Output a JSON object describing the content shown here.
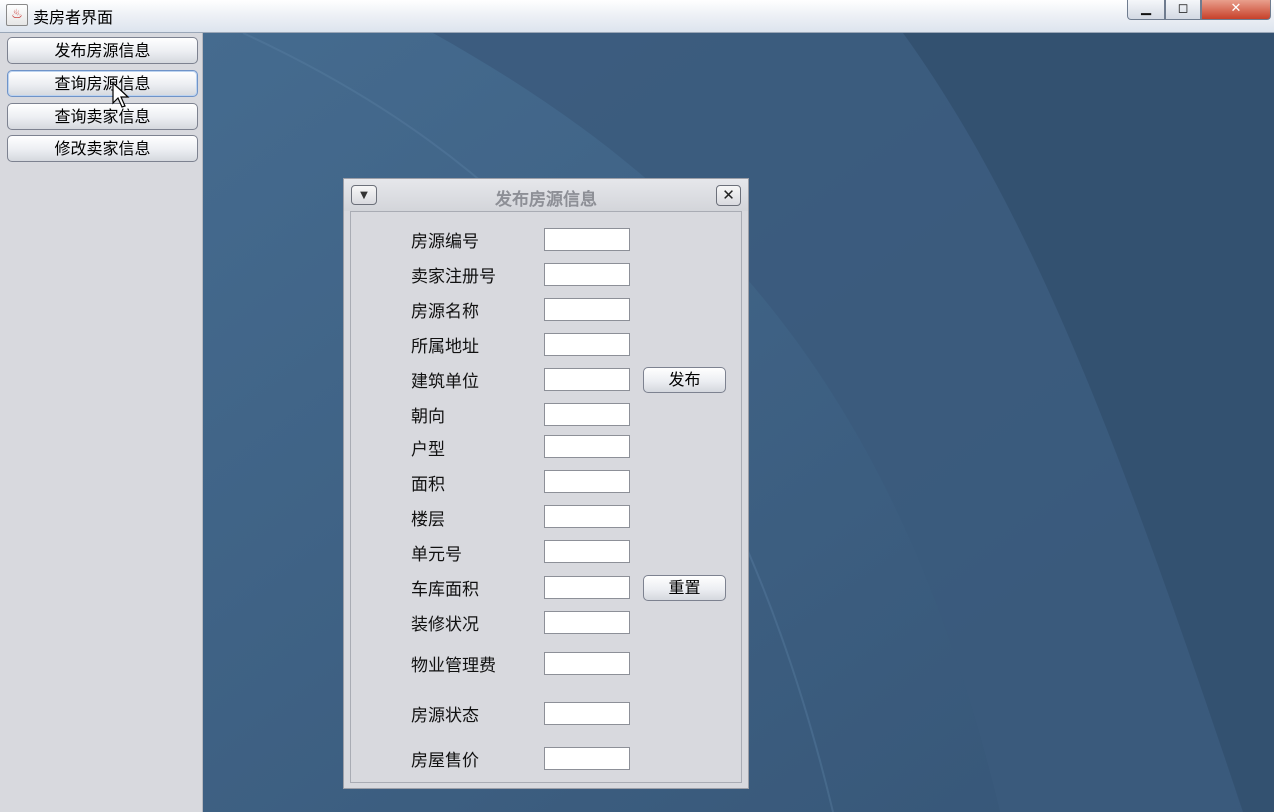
{
  "window": {
    "title": "卖房者界面",
    "app_icon": "java-icon",
    "minimize_glyph": "▁",
    "maximize_glyph": "◻",
    "close_glyph": "✕"
  },
  "sidebar": {
    "items": [
      {
        "label": "发布房源信息"
      },
      {
        "label": "查询房源信息"
      },
      {
        "label": "查询卖家信息"
      },
      {
        "label": "修改卖家信息"
      }
    ]
  },
  "form": {
    "title": "发布房源信息",
    "menu_glyph": "▼",
    "close_glyph": "✕",
    "fields": [
      {
        "label": "房源编号",
        "value": ""
      },
      {
        "label": "卖家注册号",
        "value": ""
      },
      {
        "label": "房源名称",
        "value": ""
      },
      {
        "label": "所属地址",
        "value": ""
      },
      {
        "label": "建筑单位",
        "value": ""
      },
      {
        "label": "朝向",
        "value": ""
      },
      {
        "label": "户型",
        "value": ""
      },
      {
        "label": "面积",
        "value": ""
      },
      {
        "label": "楼层",
        "value": ""
      },
      {
        "label": "单元号",
        "value": ""
      },
      {
        "label": "车库面积",
        "value": ""
      },
      {
        "label": "装修状况",
        "value": ""
      },
      {
        "label": "物业管理费",
        "value": ""
      },
      {
        "label": "房源状态",
        "value": ""
      },
      {
        "label": "房屋售价",
        "value": ""
      }
    ],
    "publish_label": "发布",
    "reset_label": "重置"
  },
  "colors": {
    "desktop": "#3c5d7e",
    "panel": "#d8d9de"
  }
}
